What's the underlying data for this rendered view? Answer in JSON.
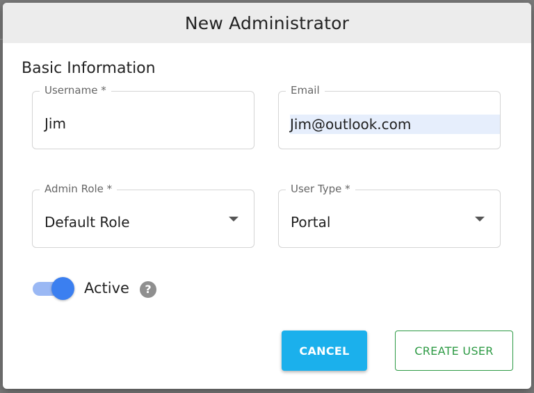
{
  "dialog": {
    "title": "New Administrator"
  },
  "section": {
    "title": "Basic Information"
  },
  "fields": {
    "username": {
      "label": "Username *",
      "value": "Jim"
    },
    "email": {
      "label": "Email",
      "value": "Jim@outlook.com"
    },
    "admin_role": {
      "label": "Admin Role *",
      "value": "Default Role"
    },
    "user_type": {
      "label": "User Type *",
      "value": "Portal"
    }
  },
  "active_toggle": {
    "label": "Active",
    "checked": true
  },
  "help_icon_glyph": "?",
  "buttons": {
    "cancel": "CANCEL",
    "create_user": "CREATE USER"
  },
  "colors": {
    "header_bg": "#ececec",
    "toggle_on": "#3b7ff0",
    "cancel_bg": "#1bb0ec",
    "create_outline": "#2d9a44"
  },
  "icons": {
    "select_caret": "caret-down-icon",
    "help": "help-icon"
  }
}
